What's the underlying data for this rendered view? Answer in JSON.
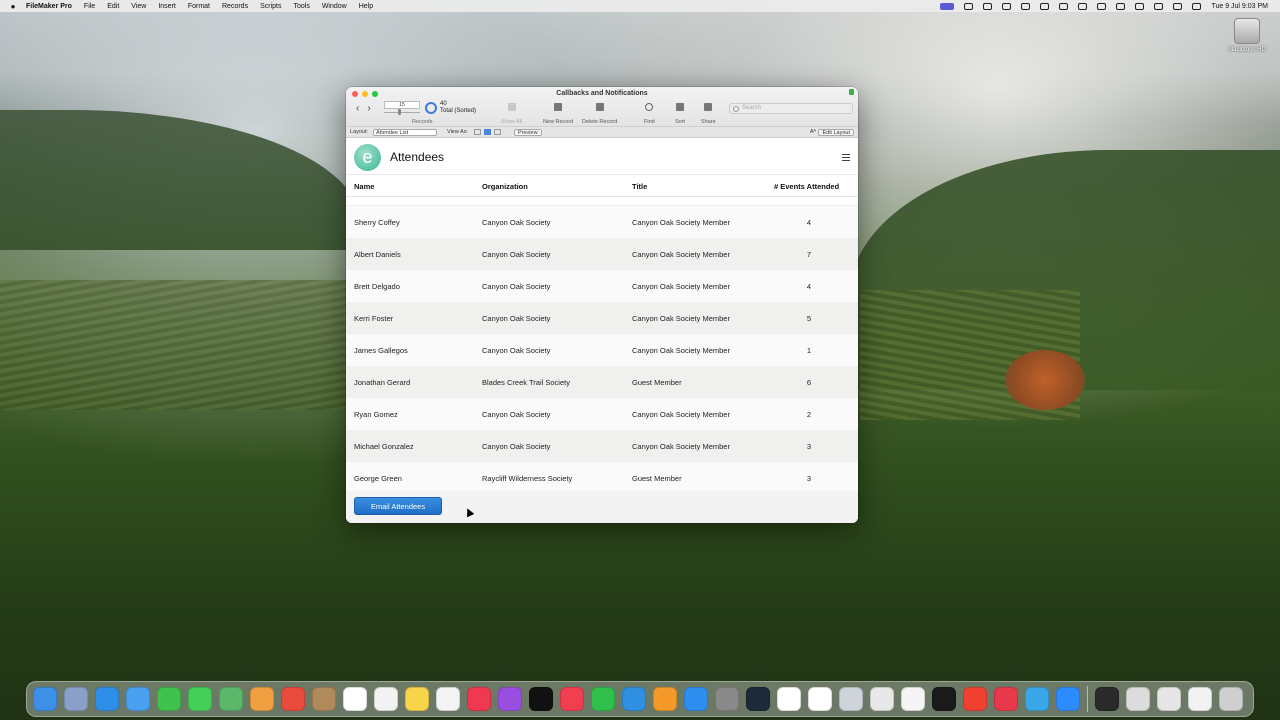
{
  "menubar": {
    "app": "FileMaker Pro",
    "items": [
      "File",
      "Edit",
      "View",
      "Insert",
      "Format",
      "Records",
      "Scripts",
      "Tools",
      "Window",
      "Help"
    ],
    "clock": "Tue 9 Jul  9:03 PM"
  },
  "desktop": {
    "hd_label": "Macintosh HD"
  },
  "window": {
    "title": "Callbacks and Notifications",
    "records": {
      "current": "15",
      "total": "40",
      "total_label": "Total (Sorted)",
      "label": "Records"
    },
    "toolbar": {
      "show_all": "Show All",
      "new_record": "New Record",
      "delete_record": "Delete Record",
      "find": "Find",
      "sort": "Sort",
      "share": "Share",
      "search_placeholder": "Search"
    },
    "layoutbar": {
      "layout_label": "Layout:",
      "layout_value": "Attendee List",
      "view_as_label": "View As:",
      "preview": "Preview",
      "text_size": "Aᴬ",
      "edit_layout": "Edit Layout"
    },
    "page": {
      "logo_letter": "e",
      "title": "Attendees",
      "columns": {
        "name": "Name",
        "organization": "Organization",
        "title": "Title",
        "events": "# Events Attended"
      },
      "rows": [
        {
          "name": "Sherry Coffey",
          "organization": "Canyon Oak Society",
          "title": "Canyon Oak Society Member",
          "events": "4"
        },
        {
          "name": "Albert Daniels",
          "organization": "Canyon Oak Society",
          "title": "Canyon Oak Society Member",
          "events": "7"
        },
        {
          "name": "Brett Delgado",
          "organization": "Canyon Oak Society",
          "title": "Canyon Oak Society Member",
          "events": "4"
        },
        {
          "name": "Kerri Foster",
          "organization": "Canyon Oak Society",
          "title": "Canyon Oak Society Member",
          "events": "5"
        },
        {
          "name": "James Gallegos",
          "organization": "Canyon Oak Society",
          "title": "Canyon Oak Society Member",
          "events": "1"
        },
        {
          "name": "Jonathan Gerard",
          "organization": "Blades Creek Trail Society",
          "title": "Guest Member",
          "events": "6"
        },
        {
          "name": "Ryan Gomez",
          "organization": "Canyon Oak Society",
          "title": "Canyon Oak Society Member",
          "events": "2"
        },
        {
          "name": "Michael Gonzalez",
          "organization": "Canyon Oak Society",
          "title": "Canyon Oak Society Member",
          "events": "3"
        },
        {
          "name": "George Green",
          "organization": "Raycliff Wilderness Society",
          "title": "Guest Member",
          "events": "3"
        }
      ],
      "email_button": "Email Attendees"
    }
  },
  "dock": {
    "icons": [
      {
        "name": "finder-icon",
        "color": "#3d8fe8"
      },
      {
        "name": "launchpad-icon",
        "color": "#8aa0c8"
      },
      {
        "name": "safari-icon",
        "color": "#2f8fe8"
      },
      {
        "name": "mail-icon",
        "color": "#4aa0f0"
      },
      {
        "name": "facetime-icon",
        "color": "#3fc24e"
      },
      {
        "name": "messages-icon",
        "color": "#44d058"
      },
      {
        "name": "maps-icon",
        "color": "#5bb86a"
      },
      {
        "name": "photos-icon",
        "color": "#f0a040"
      },
      {
        "name": "chrome-icon",
        "color": "#e84a3c"
      },
      {
        "name": "contacts-icon",
        "color": "#b08a5a"
      },
      {
        "name": "calendar-icon",
        "color": "#ffffff"
      },
      {
        "name": "reminders-icon",
        "color": "#f2f2f2"
      },
      {
        "name": "notes-icon",
        "color": "#f7d44a"
      },
      {
        "name": "freeform-icon",
        "color": "#f4f4f4"
      },
      {
        "name": "music-icon",
        "color": "#f0384e"
      },
      {
        "name": "podcasts-icon",
        "color": "#9a4ee0"
      },
      {
        "name": "tv-icon",
        "color": "#111111"
      },
      {
        "name": "news-icon",
        "color": "#f04050"
      },
      {
        "name": "numbers-icon",
        "color": "#2fbf4a"
      },
      {
        "name": "keynote-icon",
        "color": "#2f8fe0"
      },
      {
        "name": "pages-icon",
        "color": "#f59a2a"
      },
      {
        "name": "app-store-icon",
        "color": "#2f8ff0"
      },
      {
        "name": "system-settings-icon",
        "color": "#8a8a8a"
      },
      {
        "name": "filemaker-icon",
        "color": "#1d2a3a"
      },
      {
        "name": "filemaker-pro-icon",
        "color": "#ffffff"
      },
      {
        "name": "claris-icon",
        "color": "#ffffff"
      },
      {
        "name": "preview-icon",
        "color": "#cfd4da"
      },
      {
        "name": "bbedit-icon",
        "color": "#e8e8e8"
      },
      {
        "name": "textedit-icon",
        "color": "#f5f5f5"
      },
      {
        "name": "terminal-icon",
        "color": "#1a1a1a"
      },
      {
        "name": "sketch-icon",
        "color": "#f04030"
      },
      {
        "name": "app-red-icon",
        "color": "#e8384a"
      },
      {
        "name": "app-grid-icon",
        "color": "#3aa8e8"
      },
      {
        "name": "zoom-icon",
        "color": "#2d8cff"
      },
      {
        "name": "bartender-icon",
        "color": "#2a2a2a"
      },
      {
        "name": "screen-icon",
        "color": "#dcdcdc"
      },
      {
        "name": "printer-icon",
        "color": "#e6e6e6"
      },
      {
        "name": "documents-icon",
        "color": "#f2f2f2"
      },
      {
        "name": "trash-icon",
        "color": "#cfcfcf"
      }
    ]
  }
}
